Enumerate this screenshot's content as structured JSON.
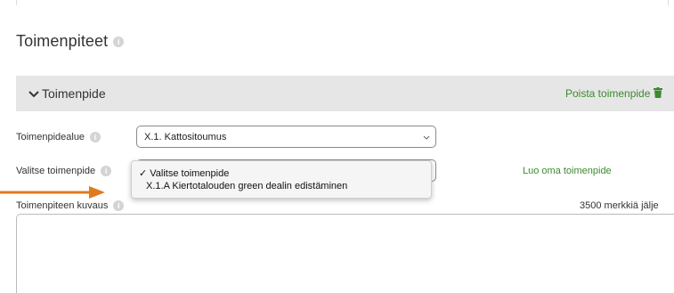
{
  "section": {
    "title": "Toimenpiteet"
  },
  "accordion": {
    "title": "Toimenpide",
    "remove_label": "Poista toimenpide"
  },
  "fields": {
    "area_label": "Toimenpidealue",
    "area_value": "X.1. Kattositoumus",
    "measure_label": "Valitse toimenpide",
    "description_label": "Toimenpiteen kuvaus",
    "char_counter": "3500 merkkiä jälje"
  },
  "dropdown": {
    "options": [
      "✓ Valitse toimenpide",
      "X.1.A Kiertotalouden green dealin edistäminen"
    ]
  },
  "custom_measure_link": "Luo oma toimenpide",
  "colors": {
    "link_green": "#3c8a2e",
    "arrow_orange": "#e07a1f",
    "accordion_bg": "#e6e6e6"
  },
  "icons": {
    "info": "info-icon",
    "chevron": "chevron-down-icon",
    "trash": "trash-icon"
  }
}
